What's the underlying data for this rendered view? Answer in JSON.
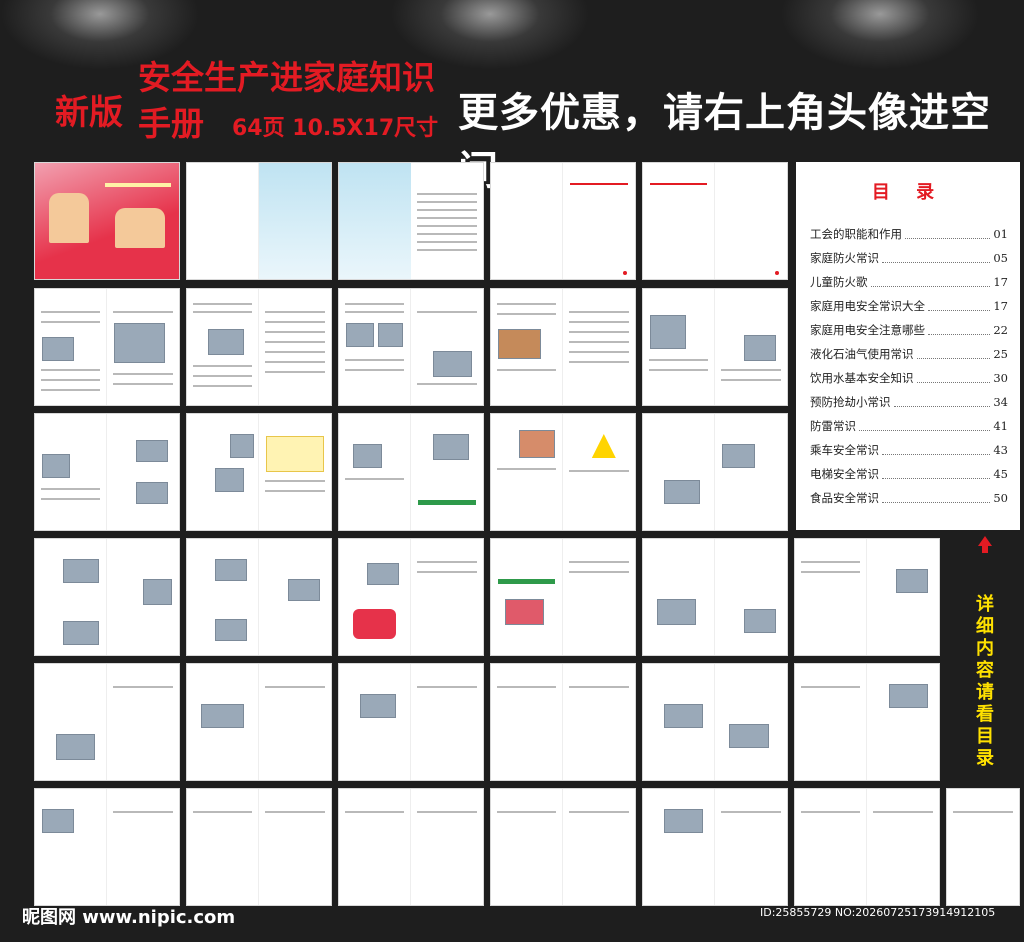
{
  "header": {
    "edition": "新版",
    "title": "安全生产进家庭知识手册",
    "spec": "64页 10.5X17尺寸",
    "promo": "更多优惠，请右上角头像进空间"
  },
  "toc": {
    "title": "目 录",
    "items": [
      {
        "label": "工会的职能和作用",
        "page": "01"
      },
      {
        "label": "家庭防火常识",
        "page": "05"
      },
      {
        "label": "儿童防火歌",
        "page": "17"
      },
      {
        "label": "家庭用电安全常识大全",
        "page": "17"
      },
      {
        "label": "家庭用电安全注意哪些",
        "page": "22"
      },
      {
        "label": "液化石油气使用常识",
        "page": "25"
      },
      {
        "label": "饮用水基本安全知识",
        "page": "30"
      },
      {
        "label": "预防抢劫小常识",
        "page": "34"
      },
      {
        "label": "防雷常识",
        "page": "41"
      },
      {
        "label": "乘车安全常识",
        "page": "43"
      },
      {
        "label": "电梯安全常识",
        "page": "45"
      },
      {
        "label": "食品安全常识",
        "page": "50"
      }
    ]
  },
  "side_note": "详细内容请看目录",
  "watermark": {
    "left": "昵图网 www.nipic.com",
    "right": "ID:25855729 NO:20260725173914912105"
  },
  "colors": {
    "accent_red": "#e31b23",
    "side_yellow": "#ffe100",
    "background": "#1e1e1e"
  }
}
